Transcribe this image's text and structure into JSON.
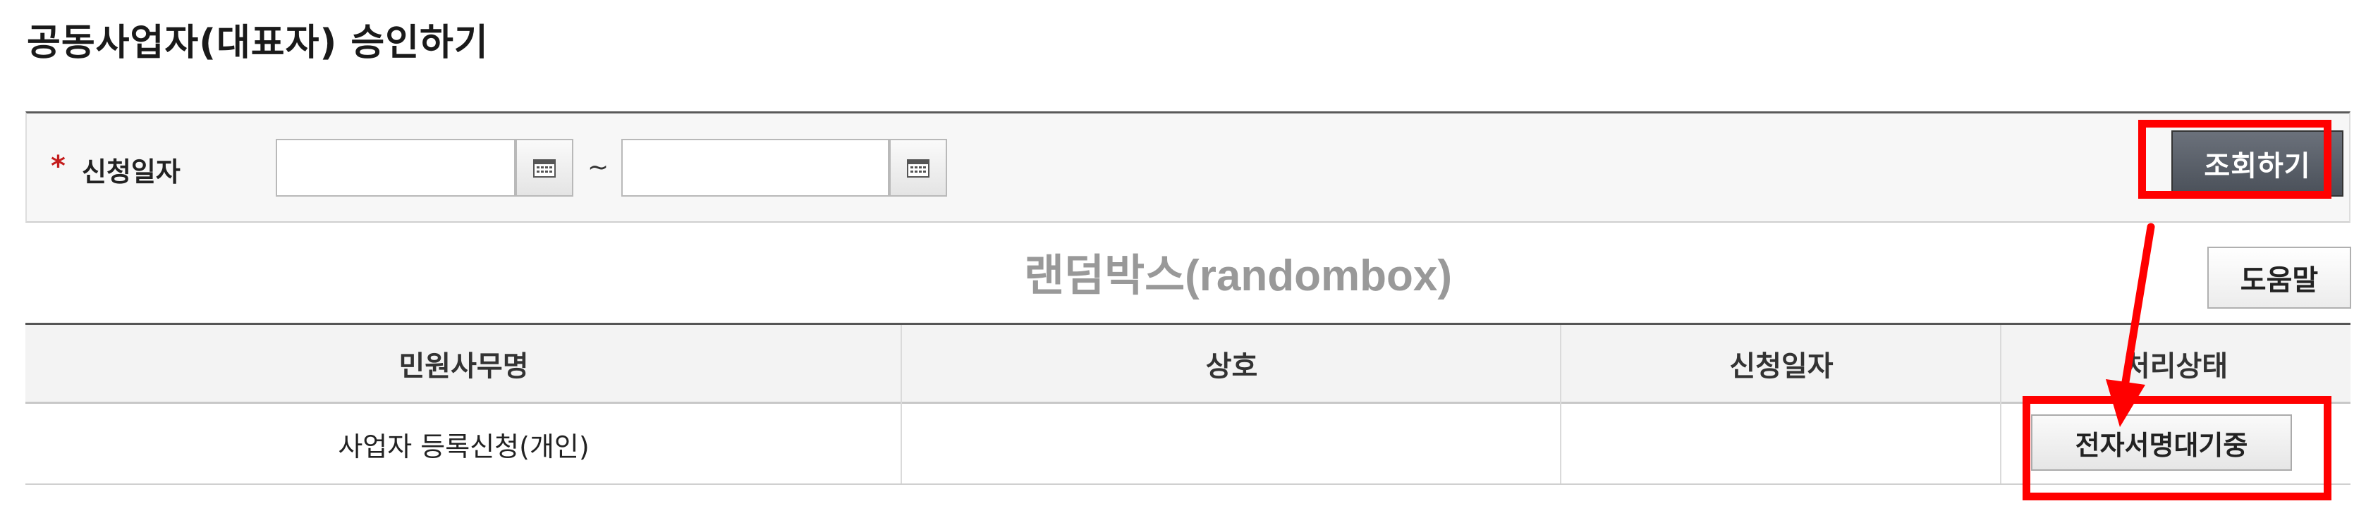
{
  "page": {
    "title": "공동사업자(대표자) 승인하기"
  },
  "search": {
    "required_mark": "*",
    "label": "신청일자",
    "date_from": {
      "value": "",
      "placeholder": ""
    },
    "date_to": {
      "value": "",
      "placeholder": ""
    },
    "range_separator": "~",
    "search_button": "조회하기"
  },
  "watermark": "랜덤박스(randombox)",
  "help_button": "도움말",
  "table": {
    "columns": [
      "민원사무명",
      "상호",
      "신청일자",
      "처리상태"
    ],
    "rows": [
      {
        "service": "사업자 등록신청(개인)",
        "company": "",
        "date": "",
        "status_button": "전자서명대기중"
      }
    ]
  },
  "colors": {
    "highlight": "#ff0000",
    "search_button_bg": "#5a6069",
    "required": "#c41d1d"
  },
  "icons": [
    "calendar-icon",
    "calendar-icon",
    "arrow-annotation"
  ]
}
